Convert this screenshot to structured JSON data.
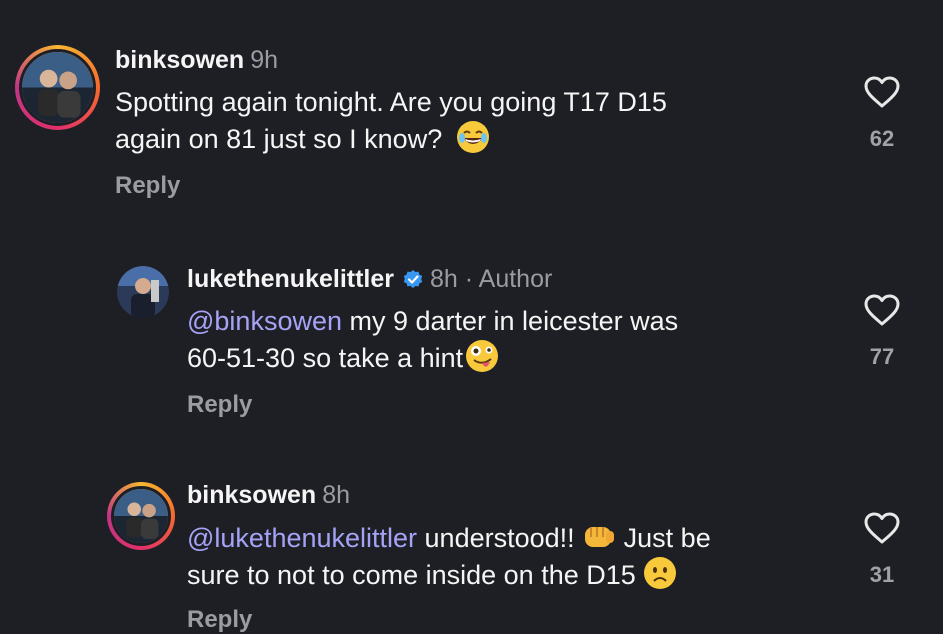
{
  "comments": [
    {
      "username": "binksowen",
      "time": "9h",
      "text_1": "Spotting again tonight. Are you going T17 D15",
      "text_2": "again on 81 just so I know?",
      "reply_label": "Reply",
      "likes": "62"
    },
    {
      "username": "lukethenukelittler",
      "time": "8h · Author",
      "mention": "@binksowen",
      "text_1": " my 9 darter in leicester was",
      "text_2": "60-51-30 so take a hint",
      "reply_label": "Reply",
      "likes": "77"
    },
    {
      "username": "binksowen",
      "time": "8h",
      "mention": "@lukethenukelittler",
      "text_1": " understood!! ",
      "text_1b": " Just be",
      "text_2": "sure to not to come inside on the D15 ",
      "reply_label": "Reply",
      "likes": "31"
    }
  ],
  "icons": {
    "like": "heart-outline-icon",
    "verified": "verified-badge-icon"
  },
  "colors": {
    "background": "#1e1f24",
    "mention": "#a6a3f7",
    "muted": "#9a9ca3",
    "verified": "#3897f0"
  }
}
